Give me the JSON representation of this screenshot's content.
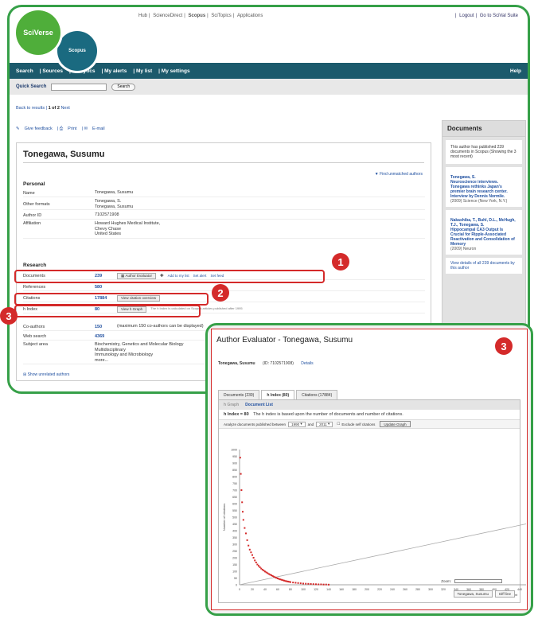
{
  "app": {
    "logo_primary": "SciVerse",
    "logo_secondary": "Scopus",
    "top_links": [
      "Hub",
      "ScienceDirect",
      "Scopus",
      "SciTopics",
      "Applications"
    ],
    "top_right": [
      "Logout",
      "Go to SciVal Suite"
    ]
  },
  "nav": {
    "items": [
      "Search",
      "Sources",
      "Analytics",
      "My alerts",
      "My list",
      "My settings"
    ],
    "help": "Help"
  },
  "quick_search": {
    "label": "Quick Search",
    "value": "",
    "button": "Search"
  },
  "breadcrumb": {
    "back": "Back to results",
    "position": "1 of 2",
    "next": "Next"
  },
  "actions": [
    "Give feedback",
    "Print",
    "E-mail"
  ],
  "author": {
    "name": "Tonegawa, Susumu",
    "find_link": "Find unmatched authors",
    "personal_title": "Personal",
    "personal": [
      {
        "label": "Name",
        "value": "Tonegawa, Susumu"
      },
      {
        "label": "Other formats",
        "value": "Tonegawa, S.\nTonegawa, Susumu"
      },
      {
        "label": "Author ID",
        "value": "7102571908"
      },
      {
        "label": "Affiliation",
        "value": "Howard Hughes Medical Institute,\nChevy Chase\nUnited States"
      }
    ],
    "research_title": "Research",
    "documents": {
      "label": "Documents",
      "value": "239",
      "buttons": [
        "Author Evaluator"
      ],
      "links": [
        "Add to my list",
        "Set alert",
        "Set feed"
      ]
    },
    "references": {
      "label": "References",
      "value": "580"
    },
    "citations": {
      "label": "Citations",
      "value": "17884",
      "button": "View citation overview"
    },
    "hindex": {
      "label": "h Index",
      "value": "80",
      "button": "View h Graph"
    },
    "notice": "The h Index is calculated on Scopus articles published after 1995",
    "coauthors": {
      "label": "Co-authors",
      "value": "150",
      "note": "(maximum 150 co-authors can be displayed)"
    },
    "websearch": {
      "label": "Web search",
      "value": "4369"
    },
    "subject": {
      "label": "Subject area",
      "value": "Biochemistry, Genetics and Molecular Biology\nMultidisciplinary\nImmunology and Microbiology\nmore..."
    },
    "show_unrelated": "Show unrelated authors"
  },
  "sidebar": {
    "title": "Documents",
    "intro": "This author has published 239 documents in Scopus (Showing the 3 most recent)",
    "docs": [
      {
        "title": "Tonegawa, S.\nNeuroscience interviews. Tonegawa rethinks Japan's premier brain research center. Interview by Dennis Normile.",
        "meta": "(2009) Science (New York, N.Y.)"
      },
      {
        "title": "Nakashiba, T., Buhl, D.L., McHugh, T.J., Tonegawa, S.\nHippocampal CA3 Output Is Crucial for Ripple-Associated Reactivation and Consolidation of Memory",
        "meta": "(2009) Neuron"
      }
    ],
    "view_all": "View details of all 239 documents by this author"
  },
  "badges": [
    "1",
    "2",
    "3",
    "3"
  ],
  "evaluator": {
    "title": "Author Evaluator - Tonegawa, Susumu",
    "author_line": "Tonegawa, Susumu",
    "author_id": "(ID: 7102571908)",
    "details": "Details",
    "tabs": [
      "Documents (239)",
      "h Index (80)",
      "Citations (17884)"
    ],
    "active_tab": 1,
    "subtabs": [
      "h Graph",
      "Document List"
    ],
    "hindex_text": "h Index = 80",
    "hindex_desc": "The h index is based upon the number of documents and number of citations.",
    "filter_label": "Analyze documents published between",
    "from_year": "1990",
    "and": "and",
    "to_year": "2011",
    "exclude_self": "Exclude self citations",
    "update_btn": "Update Graph",
    "zoom_label": "Zoom:",
    "legend": [
      "Tonegawa, Susumu",
      "Diff line"
    ]
  },
  "chart_data": {
    "type": "scatter",
    "title": "",
    "xlabel": "Document",
    "ylabel": "Number of citations",
    "xlim": [
      0,
      450
    ],
    "ylim": [
      0,
      1000
    ],
    "xticks": [
      0,
      20,
      40,
      60,
      80,
      100,
      120,
      140,
      160,
      180,
      200,
      220,
      240,
      260,
      280,
      300,
      320,
      340,
      360,
      380,
      400,
      420,
      440
    ],
    "yticks": [
      0,
      50,
      100,
      150,
      200,
      250,
      300,
      350,
      400,
      450,
      500,
      550,
      600,
      650,
      700,
      750,
      800,
      850,
      900,
      950,
      1000
    ],
    "series": [
      {
        "name": "Tonegawa, Susumu",
        "color": "#d42a2a",
        "x": [
          1,
          2,
          3,
          4,
          5,
          6,
          8,
          10,
          12,
          14,
          16,
          18,
          20,
          22,
          24,
          26,
          28,
          30,
          32,
          34,
          36,
          38,
          40,
          42,
          44,
          46,
          48,
          50,
          52,
          54,
          56,
          58,
          60,
          62,
          64,
          66,
          68,
          70,
          72,
          74,
          76,
          78,
          80,
          84,
          88,
          92,
          96,
          100,
          104,
          108,
          112,
          116,
          120,
          124,
          128,
          132,
          136,
          140
        ],
        "y": [
          940,
          820,
          700,
          610,
          540,
          480,
          420,
          380,
          330,
          290,
          260,
          240,
          220,
          200,
          180,
          165,
          150,
          140,
          130,
          120,
          112,
          105,
          98,
          92,
          86,
          80,
          75,
          70,
          65,
          60,
          55,
          51,
          47,
          43,
          40,
          37,
          34,
          31,
          28,
          26,
          24,
          22,
          20,
          17,
          15,
          13,
          11,
          9,
          8,
          7,
          6,
          5,
          4,
          3,
          3,
          2,
          2,
          1
        ]
      },
      {
        "name": "Diff line",
        "color": "#aaaaaa",
        "x": [
          0,
          450
        ],
        "y": [
          0,
          450
        ]
      }
    ]
  }
}
